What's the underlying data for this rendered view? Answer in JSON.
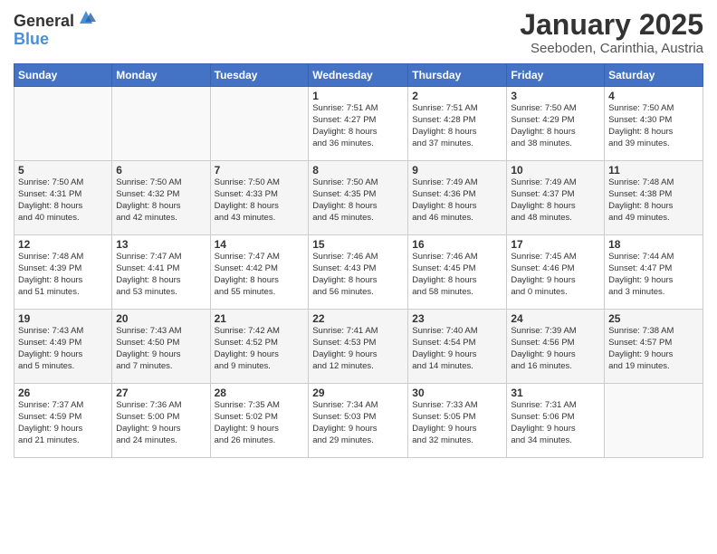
{
  "header": {
    "logo_general": "General",
    "logo_blue": "Blue",
    "month": "January 2025",
    "location": "Seeboden, Carinthia, Austria"
  },
  "days_of_week": [
    "Sunday",
    "Monday",
    "Tuesday",
    "Wednesday",
    "Thursday",
    "Friday",
    "Saturday"
  ],
  "weeks": [
    [
      {
        "day": "",
        "info": ""
      },
      {
        "day": "",
        "info": ""
      },
      {
        "day": "",
        "info": ""
      },
      {
        "day": "1",
        "info": "Sunrise: 7:51 AM\nSunset: 4:27 PM\nDaylight: 8 hours\nand 36 minutes."
      },
      {
        "day": "2",
        "info": "Sunrise: 7:51 AM\nSunset: 4:28 PM\nDaylight: 8 hours\nand 37 minutes."
      },
      {
        "day": "3",
        "info": "Sunrise: 7:50 AM\nSunset: 4:29 PM\nDaylight: 8 hours\nand 38 minutes."
      },
      {
        "day": "4",
        "info": "Sunrise: 7:50 AM\nSunset: 4:30 PM\nDaylight: 8 hours\nand 39 minutes."
      }
    ],
    [
      {
        "day": "5",
        "info": "Sunrise: 7:50 AM\nSunset: 4:31 PM\nDaylight: 8 hours\nand 40 minutes."
      },
      {
        "day": "6",
        "info": "Sunrise: 7:50 AM\nSunset: 4:32 PM\nDaylight: 8 hours\nand 42 minutes."
      },
      {
        "day": "7",
        "info": "Sunrise: 7:50 AM\nSunset: 4:33 PM\nDaylight: 8 hours\nand 43 minutes."
      },
      {
        "day": "8",
        "info": "Sunrise: 7:50 AM\nSunset: 4:35 PM\nDaylight: 8 hours\nand 45 minutes."
      },
      {
        "day": "9",
        "info": "Sunrise: 7:49 AM\nSunset: 4:36 PM\nDaylight: 8 hours\nand 46 minutes."
      },
      {
        "day": "10",
        "info": "Sunrise: 7:49 AM\nSunset: 4:37 PM\nDaylight: 8 hours\nand 48 minutes."
      },
      {
        "day": "11",
        "info": "Sunrise: 7:48 AM\nSunset: 4:38 PM\nDaylight: 8 hours\nand 49 minutes."
      }
    ],
    [
      {
        "day": "12",
        "info": "Sunrise: 7:48 AM\nSunset: 4:39 PM\nDaylight: 8 hours\nand 51 minutes."
      },
      {
        "day": "13",
        "info": "Sunrise: 7:47 AM\nSunset: 4:41 PM\nDaylight: 8 hours\nand 53 minutes."
      },
      {
        "day": "14",
        "info": "Sunrise: 7:47 AM\nSunset: 4:42 PM\nDaylight: 8 hours\nand 55 minutes."
      },
      {
        "day": "15",
        "info": "Sunrise: 7:46 AM\nSunset: 4:43 PM\nDaylight: 8 hours\nand 56 minutes."
      },
      {
        "day": "16",
        "info": "Sunrise: 7:46 AM\nSunset: 4:45 PM\nDaylight: 8 hours\nand 58 minutes."
      },
      {
        "day": "17",
        "info": "Sunrise: 7:45 AM\nSunset: 4:46 PM\nDaylight: 9 hours\nand 0 minutes."
      },
      {
        "day": "18",
        "info": "Sunrise: 7:44 AM\nSunset: 4:47 PM\nDaylight: 9 hours\nand 3 minutes."
      }
    ],
    [
      {
        "day": "19",
        "info": "Sunrise: 7:43 AM\nSunset: 4:49 PM\nDaylight: 9 hours\nand 5 minutes."
      },
      {
        "day": "20",
        "info": "Sunrise: 7:43 AM\nSunset: 4:50 PM\nDaylight: 9 hours\nand 7 minutes."
      },
      {
        "day": "21",
        "info": "Sunrise: 7:42 AM\nSunset: 4:52 PM\nDaylight: 9 hours\nand 9 minutes."
      },
      {
        "day": "22",
        "info": "Sunrise: 7:41 AM\nSunset: 4:53 PM\nDaylight: 9 hours\nand 12 minutes."
      },
      {
        "day": "23",
        "info": "Sunrise: 7:40 AM\nSunset: 4:54 PM\nDaylight: 9 hours\nand 14 minutes."
      },
      {
        "day": "24",
        "info": "Sunrise: 7:39 AM\nSunset: 4:56 PM\nDaylight: 9 hours\nand 16 minutes."
      },
      {
        "day": "25",
        "info": "Sunrise: 7:38 AM\nSunset: 4:57 PM\nDaylight: 9 hours\nand 19 minutes."
      }
    ],
    [
      {
        "day": "26",
        "info": "Sunrise: 7:37 AM\nSunset: 4:59 PM\nDaylight: 9 hours\nand 21 minutes."
      },
      {
        "day": "27",
        "info": "Sunrise: 7:36 AM\nSunset: 5:00 PM\nDaylight: 9 hours\nand 24 minutes."
      },
      {
        "day": "28",
        "info": "Sunrise: 7:35 AM\nSunset: 5:02 PM\nDaylight: 9 hours\nand 26 minutes."
      },
      {
        "day": "29",
        "info": "Sunrise: 7:34 AM\nSunset: 5:03 PM\nDaylight: 9 hours\nand 29 minutes."
      },
      {
        "day": "30",
        "info": "Sunrise: 7:33 AM\nSunset: 5:05 PM\nDaylight: 9 hours\nand 32 minutes."
      },
      {
        "day": "31",
        "info": "Sunrise: 7:31 AM\nSunset: 5:06 PM\nDaylight: 9 hours\nand 34 minutes."
      },
      {
        "day": "",
        "info": ""
      }
    ]
  ]
}
